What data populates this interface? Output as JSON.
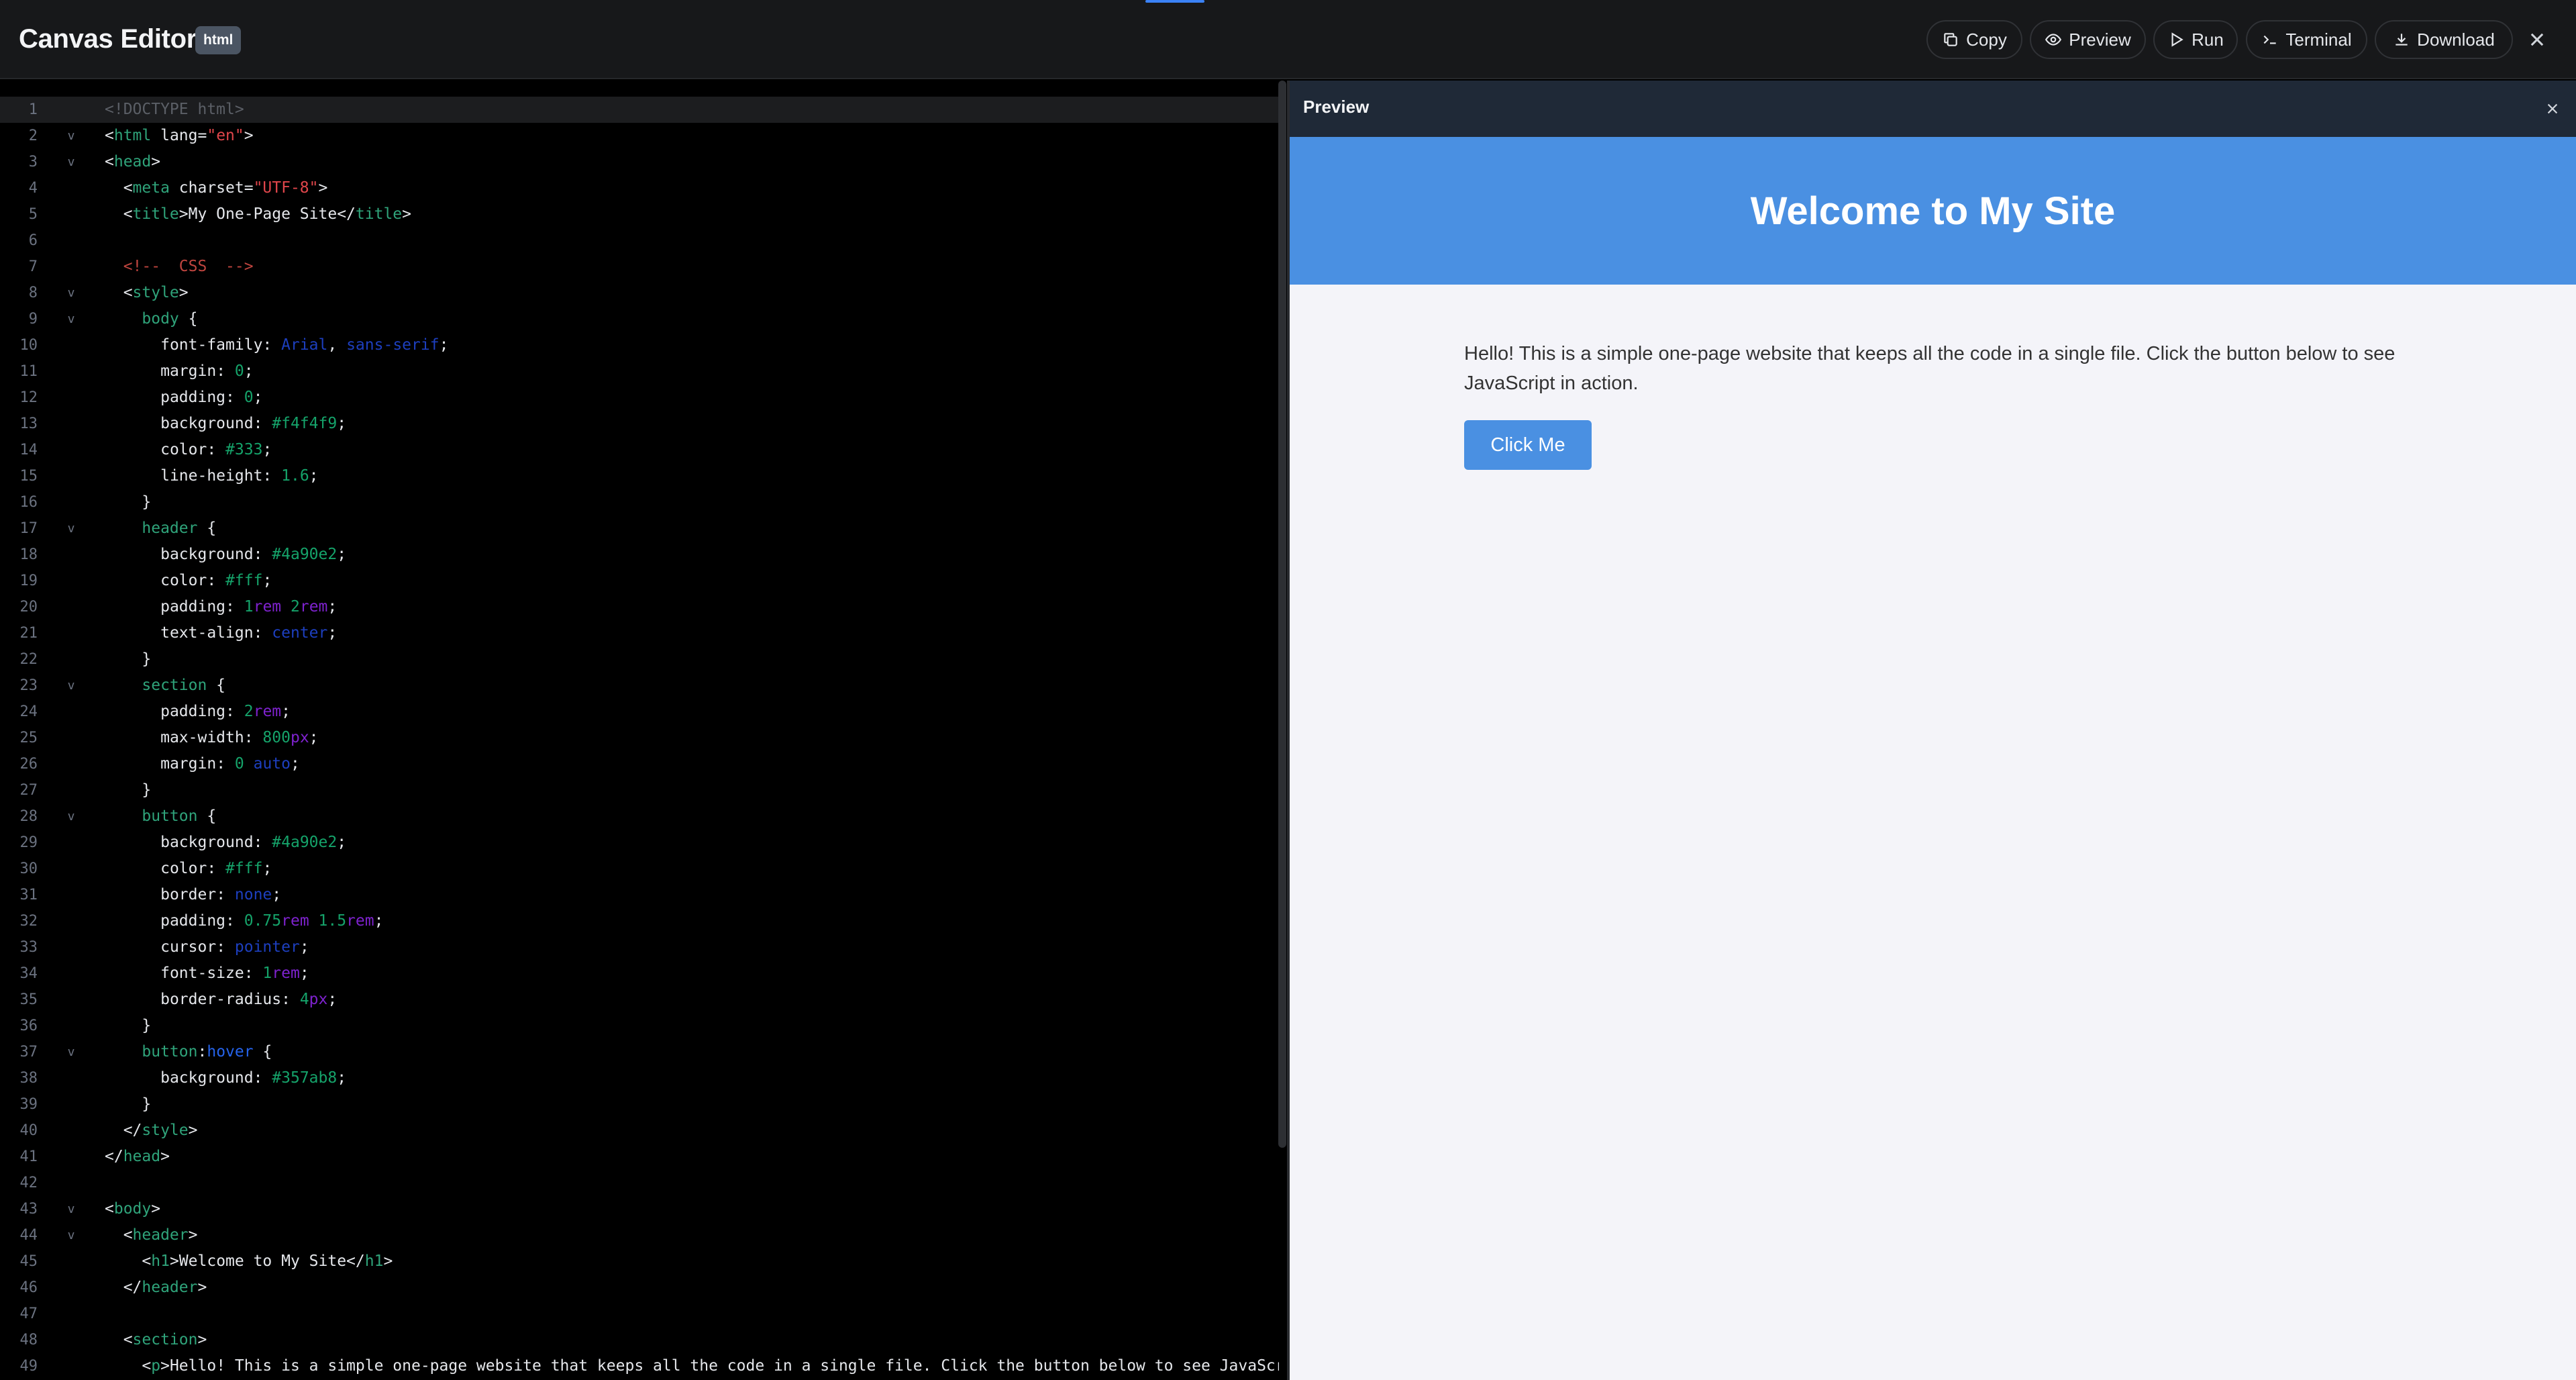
{
  "app": {
    "title": "Canvas Editor",
    "language_badge": "html"
  },
  "toolbar": {
    "copy_label": "Copy",
    "preview_label": "Preview",
    "run_label": "Run",
    "terminal_label": "Terminal",
    "download_label": "Download"
  },
  "editor": {
    "active_line": 1,
    "fold_lines": [
      2,
      3,
      8,
      9,
      17,
      23,
      28,
      37,
      43,
      44
    ],
    "lines": [
      "<!DOCTYPE html>",
      "<html lang=\"en\">",
      "<head>",
      "  <meta charset=\"UTF-8\">",
      "  <title>My One-Page Site</title>",
      "",
      "  <!--  CSS  -->",
      "  <style>",
      "    body {",
      "      font-family: Arial, sans-serif;",
      "      margin: 0;",
      "      padding: 0;",
      "      background: #f4f4f9;",
      "      color: #333;",
      "      line-height: 1.6;",
      "    }",
      "    header {",
      "      background: #4a90e2;",
      "      color: #fff;",
      "      padding: 1rem 2rem;",
      "      text-align: center;",
      "    }",
      "    section {",
      "      padding: 2rem;",
      "      max-width: 800px;",
      "      margin: 0 auto;",
      "    }",
      "    button {",
      "      background: #4a90e2;",
      "      color: #fff;",
      "      border: none;",
      "      padding: 0.75rem 1.5rem;",
      "      cursor: pointer;",
      "      font-size: 1rem;",
      "      border-radius: 4px;",
      "    }",
      "    button:hover {",
      "      background: #357ab8;",
      "    }",
      "  </style>",
      "</head>",
      "",
      "<body>",
      "  <header>",
      "    <h1>Welcome to My Site</h1>",
      "  </header>",
      "",
      "  <section>",
      "    <p>Hello! This is a simple one-page website that keeps all the code in a single file. Click the button below to see JavaScript"
    ]
  },
  "preview": {
    "panel_title": "Preview",
    "site": {
      "heading": "Welcome to My Site",
      "paragraph": "Hello! This is a simple one-page website that keeps all the code in a single file. Click the button below to see JavaScript in action.",
      "button_label": "Click Me"
    }
  },
  "colors": {
    "accent": "#3b82f6",
    "site_header": "#4a90e2",
    "site_background": "#f4f4f9",
    "site_text": "#333333",
    "preview_bar": "#1f2937"
  }
}
